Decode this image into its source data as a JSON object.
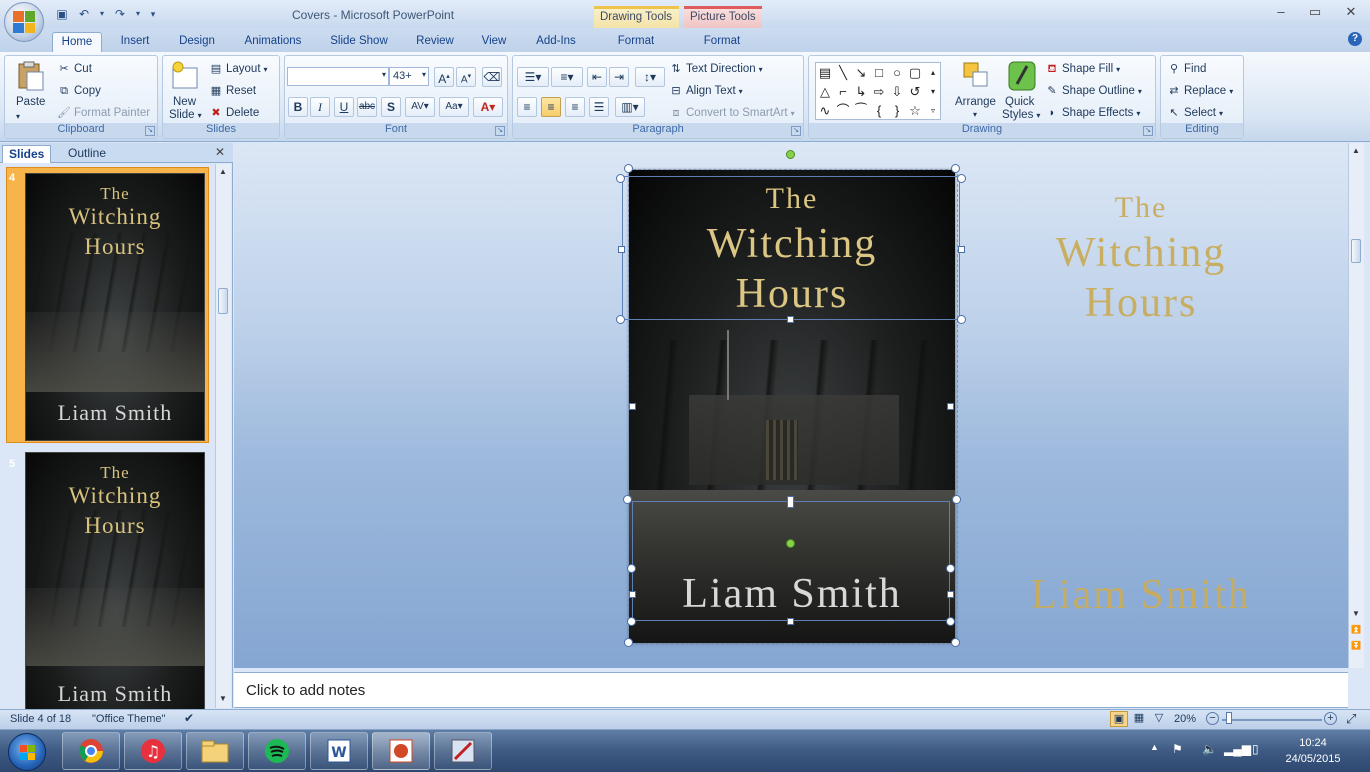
{
  "window": {
    "title": "Covers - Microsoft PowerPoint",
    "context_tabs": {
      "drawing_tools": "Drawing Tools",
      "picture_tools": "Picture Tools"
    },
    "controls": {
      "minimize": "–",
      "restore": "▭",
      "close": "✕"
    }
  },
  "tabs": [
    "Home",
    "Insert",
    "Design",
    "Animations",
    "Slide Show",
    "Review",
    "View",
    "Add-Ins",
    "Format",
    "Format"
  ],
  "active_tab": "Home",
  "ribbon": {
    "clipboard": {
      "label": "Clipboard",
      "paste": "Paste",
      "cut": "Cut",
      "copy": "Copy",
      "format_painter": "Format Painter"
    },
    "slides": {
      "label": "Slides",
      "new_slide_1": "New",
      "new_slide_2": "Slide",
      "layout": "Layout",
      "reset": "Reset",
      "delete": "Delete"
    },
    "font": {
      "label": "Font",
      "font_name": "",
      "font_size": "43+"
    },
    "paragraph": {
      "label": "Paragraph",
      "text_direction": "Text Direction",
      "align_text": "Align Text",
      "convert_smartart": "Convert to SmartArt"
    },
    "drawing": {
      "label": "Drawing",
      "arrange": "Arrange",
      "quick_styles_1": "Quick",
      "quick_styles_2": "Styles",
      "shape_fill": "Shape Fill",
      "shape_outline": "Shape Outline",
      "shape_effects": "Shape Effects"
    },
    "editing": {
      "label": "Editing",
      "find": "Find",
      "replace": "Replace",
      "select": "Select"
    }
  },
  "slides_pane": {
    "tabs": [
      "Slides",
      "Outline"
    ],
    "thumbnails": [
      {
        "number": "4",
        "the": "The",
        "title1": "Witching",
        "title2": "Hours",
        "author": "Liam Smith",
        "selected": true
      },
      {
        "number": "5",
        "the": "The",
        "title1": "Witching",
        "title2": "Hours",
        "author": "Liam Smith",
        "selected": false
      }
    ]
  },
  "slide": {
    "cover": {
      "the": "The",
      "title1": "Witching",
      "title2": "Hours",
      "author": "Liam Smith"
    },
    "ghost": {
      "the": "The",
      "title1": "Witching",
      "title2": "Hours",
      "author": "Liam Smith"
    }
  },
  "notes_placeholder": "Click to add notes",
  "status": {
    "slide_info": "Slide 4 of 18",
    "theme": "\"Office Theme\"",
    "zoom": "20%"
  },
  "taskbar": {
    "time": "10:24",
    "date": "24/05/2015"
  },
  "colors": {
    "gold": "#d8c27e",
    "accent_selected": "#f7b44a",
    "ribbon_blue": "#15428b"
  }
}
